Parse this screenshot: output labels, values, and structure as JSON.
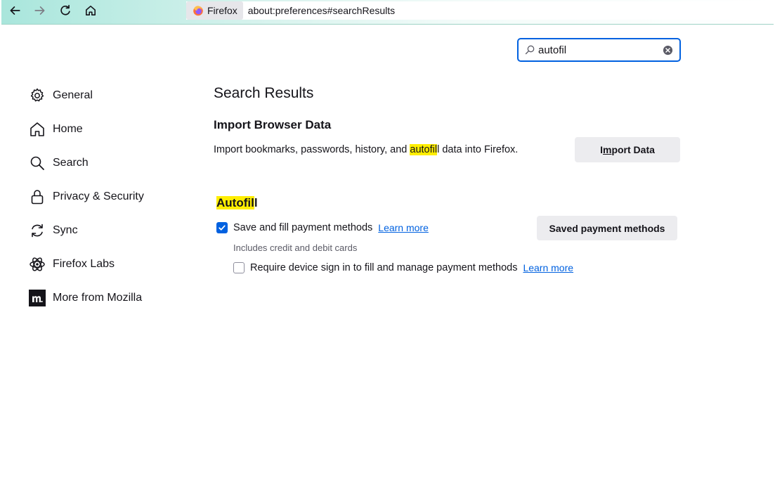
{
  "browser": {
    "identity_label": "Firefox",
    "url": "about:preferences#searchResults"
  },
  "search": {
    "value": "autofil",
    "placeholder": ""
  },
  "sidebar": {
    "items": [
      {
        "label": "General",
        "icon": "gear-icon"
      },
      {
        "label": "Home",
        "icon": "home-icon"
      },
      {
        "label": "Search",
        "icon": "search-icon"
      },
      {
        "label": "Privacy & Security",
        "icon": "lock-icon"
      },
      {
        "label": "Sync",
        "icon": "sync-icon"
      },
      {
        "label": "Firefox Labs",
        "icon": "atom-icon"
      },
      {
        "label": "More from Mozilla",
        "icon": "mozilla-icon"
      }
    ]
  },
  "main": {
    "title": "Search Results",
    "import": {
      "heading": "Import Browser Data",
      "desc_before": "Import bookmarks, passwords, history, and ",
      "desc_highlight": "autofil",
      "desc_after": "l data into Firefox.",
      "button_pre": "I",
      "button_accesskey": "m",
      "button_post": "port Data"
    },
    "autofill": {
      "heading_highlight": "Autofil",
      "heading_rest": "l",
      "save_payment_label": "Save and fill payment methods",
      "learn_more_1": "Learn more",
      "saved_payment_button": "Saved payment methods",
      "includes_note": "Includes credit and debit cards",
      "require_signin_label": "Require device sign in to fill and manage payment methods",
      "learn_more_2": "Learn more",
      "save_payment_checked": true,
      "require_signin_checked": false
    }
  },
  "colors": {
    "accent": "#0061e0",
    "highlight": "#ffee00",
    "button_bg": "#ececef"
  }
}
